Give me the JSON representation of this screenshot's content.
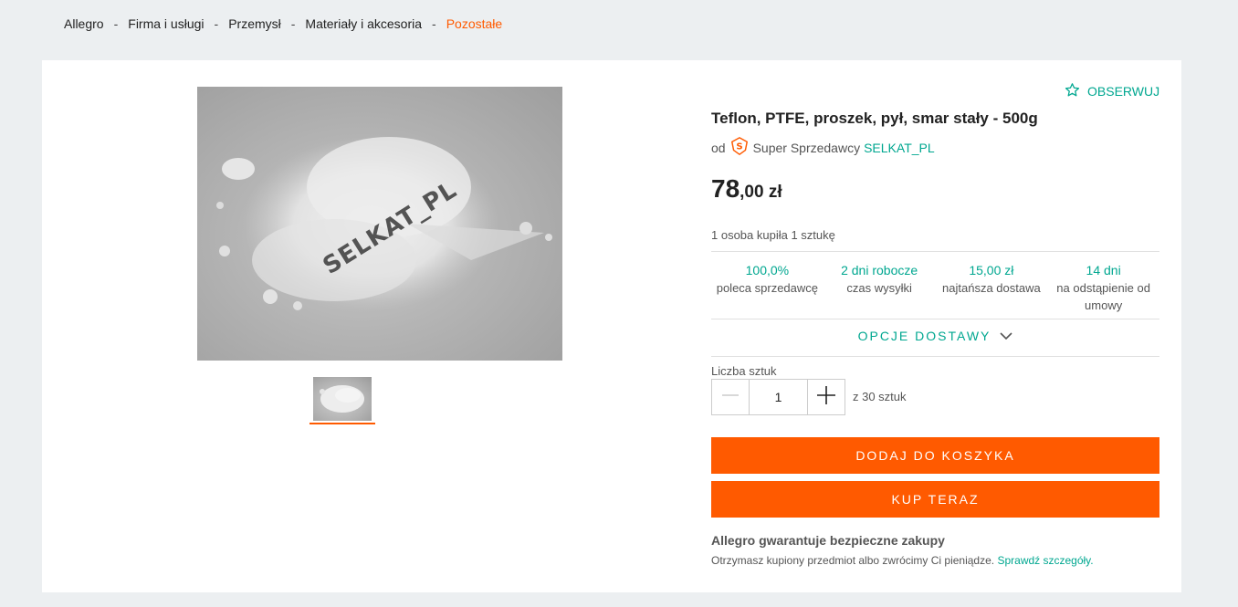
{
  "breadcrumb": {
    "items": [
      "Allegro",
      "Firma i usługi",
      "Przemysł",
      "Materiały i akcesoria",
      "Pozostałe"
    ],
    "separator": "-"
  },
  "gallery": {
    "watermark": "SELKAT_PL",
    "thumbnail_count": 1,
    "selected_thumbnail": 1
  },
  "product": {
    "watch_label": "OBSERWUJ",
    "title": "Teflon, PTFE, proszek, pył, smar stały - 500g",
    "seller_prefix": "od",
    "seller_type": "Super Sprzedawcy",
    "seller_name": "SELKAT_PL",
    "price_main": "78",
    "price_fraction": ",00 zł",
    "bought_info": "1 osoba kupiła 1 sztukę"
  },
  "stats": [
    {
      "value": "100,0%",
      "label": "poleca sprzedawcę"
    },
    {
      "value": "2 dni robocze",
      "label": "czas wysyłki"
    },
    {
      "value": "15,00 zł",
      "label": "najtańsza dostawa"
    },
    {
      "value": "14 dni",
      "label": "na odstąpienie od umowy"
    }
  ],
  "delivery_options_label": "OPCJE DOSTAWY",
  "quantity": {
    "label": "Liczba sztuk",
    "value": "1",
    "available": "z 30 sztuk"
  },
  "buttons": {
    "add_to_cart": "DODAJ DO KOSZYKA",
    "buy_now": "KUP TERAZ"
  },
  "guarantee": {
    "title": "Allegro gwarantuje bezpieczne zakupy",
    "text": "Otrzymasz kupiony przedmiot albo zwrócimy Ci pieniądze.",
    "link": "Sprawdź szczegóły."
  },
  "colors": {
    "accent": "#ff5a00",
    "link": "#00a790",
    "background": "#eceff1"
  },
  "icons": [
    "star-outline-icon",
    "super-seller-badge-icon",
    "chevron-down-icon",
    "minus-icon",
    "plus-icon"
  ]
}
